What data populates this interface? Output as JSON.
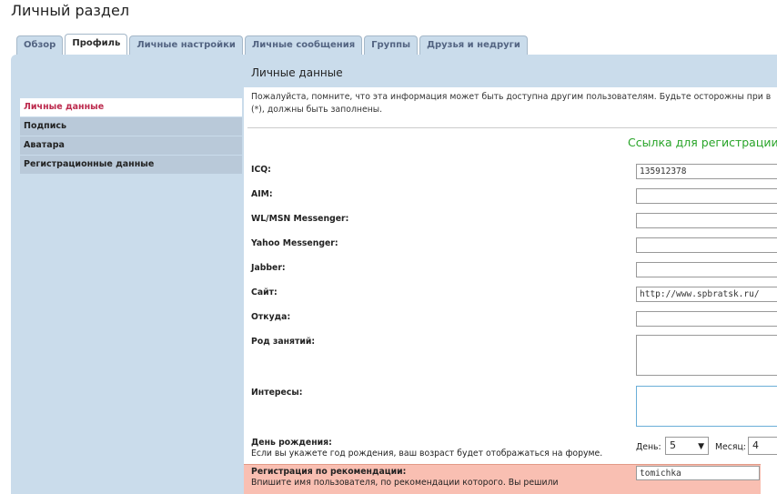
{
  "page_title": "Личный раздел",
  "tabs": [
    {
      "label": "Обзор",
      "active": false
    },
    {
      "label": "Профиль",
      "active": true
    },
    {
      "label": "Личные настройки",
      "active": false
    },
    {
      "label": "Личные сообщения",
      "active": false
    },
    {
      "label": "Группы",
      "active": false
    },
    {
      "label": "Друзья и недруги",
      "active": false
    }
  ],
  "sidebar": {
    "items": [
      {
        "label": "Личные данные",
        "active": true
      },
      {
        "label": "Подпись",
        "active": false
      },
      {
        "label": "Аватара",
        "active": false
      },
      {
        "label": "Регистрационные данные",
        "active": false
      }
    ]
  },
  "content": {
    "title": "Личные данные",
    "notice_line1": "Пожалуйста, помните, что эта информация может быть доступна другим пользователям. Будьте осторожны при в",
    "notice_line2": "(*), должны быть заполнены.",
    "registration_link": "Ссылка для регистрации"
  },
  "fields": {
    "icq": {
      "label": "ICQ:",
      "value": "135912378"
    },
    "aim": {
      "label": "AIM:",
      "value": ""
    },
    "msn": {
      "label": "WL/MSN Messenger:",
      "value": ""
    },
    "yahoo": {
      "label": "Yahoo Messenger:",
      "value": ""
    },
    "jabber": {
      "label": "Jabber:",
      "value": ""
    },
    "website": {
      "label": "Сайт:",
      "value": "http://www.spbratsk.ru/"
    },
    "location": {
      "label": "Откуда:",
      "value": ""
    },
    "occupation": {
      "label": "Род занятий:",
      "value": ""
    },
    "interests": {
      "label": "Интересы:",
      "value": ""
    }
  },
  "birthday": {
    "label": "День рождения:",
    "hint": "Если вы укажете год рождения, ваш возраст будет отображаться на форуме.",
    "day_label": "День:",
    "day_value": "5",
    "month_label": "Месяц:",
    "month_value": "4"
  },
  "referral": {
    "label": "Регистрация по рекомендации:",
    "hint": "Впишите имя пользователя, по рекомендации которого. Вы решили",
    "value": "tomichka"
  },
  "colors": {
    "panel_bg": "#cadceb",
    "active_sidebar_text": "#bc2a4d",
    "link_green": "#28a428",
    "highlight_bg": "#f9bfb2"
  }
}
